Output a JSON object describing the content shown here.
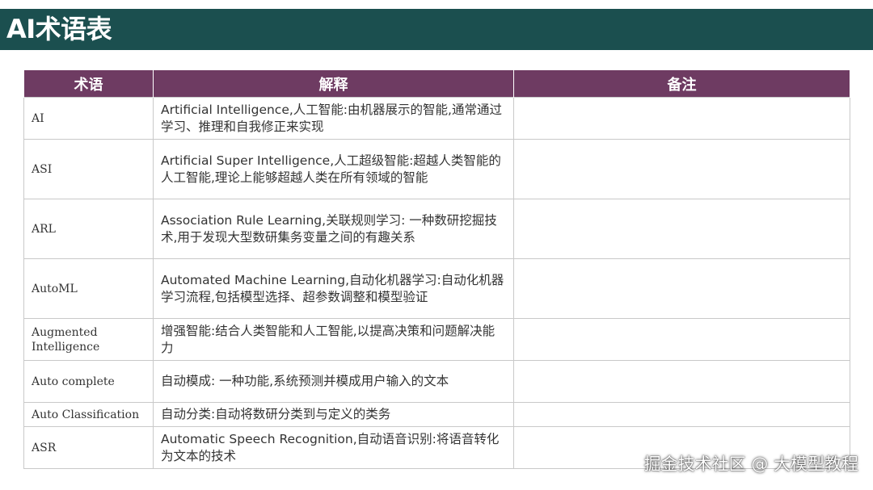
{
  "title": "AI术语表",
  "columns": [
    "术语",
    "解释",
    "备注"
  ],
  "rows": [
    {
      "term": "AI",
      "explain": "Artificial Intelligence,人工智能:由机器展示的智能,通常通过学习、推理和自我修正来实现",
      "note": ""
    },
    {
      "term": "ASI",
      "explain": "Artificial Super Intelligence,人工超级智能:超越人类智能的人工智能,理论上能够超越人类在所有领域的智能",
      "note": ""
    },
    {
      "term": "ARL",
      "explain": "Association Rule Learning,关联规则学习: 一种数研挖掘技术,用于发现大型数研集务变量之间的有趣关系",
      "note": ""
    },
    {
      "term": "AutoML",
      "explain": "Automated Machine Learning,自动化机器学习:自动化机器学习流程,包括模型选择、超参数调整和模型验证",
      "note": ""
    },
    {
      "term": "Augmented Intelligence",
      "explain": "增强智能:结合人类智能和人工智能,以提高决策和问题解决能力",
      "note": ""
    },
    {
      "term": "Auto complete",
      "explain": "自动模成: 一种功能,系统预测并模成用户输入的文本",
      "note": ""
    },
    {
      "term": "Auto Classification",
      "explain": "自动分类:自动将数研分类到与定义的类务",
      "note": ""
    },
    {
      "term": "ASR",
      "explain": "Automatic Speech Recognition,自动语音识别:将语音转化为文本的技术",
      "note": ""
    }
  ],
  "watermark": "掘金技术社区 @ 大模型教程"
}
